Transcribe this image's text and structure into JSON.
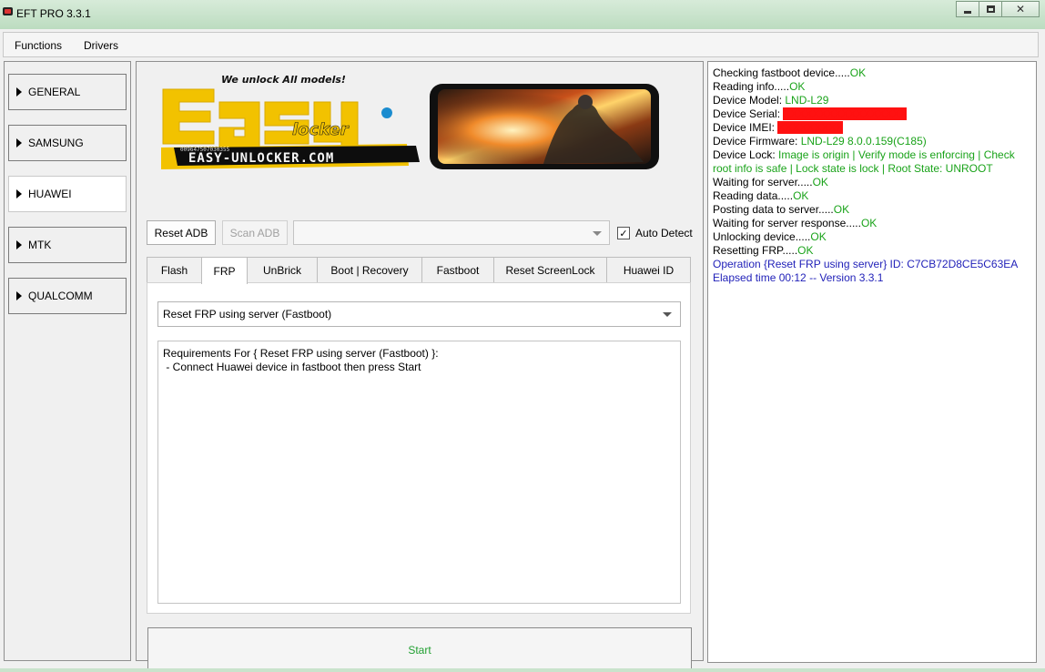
{
  "window": {
    "title": "EFT PRO 3.3.1"
  },
  "menu": [
    "Functions",
    "Drivers"
  ],
  "sidebar": {
    "items": [
      {
        "label": "GENERAL",
        "active": false
      },
      {
        "label": "SAMSUNG",
        "active": false
      },
      {
        "label": "HUAWEI",
        "active": true
      },
      {
        "label": "MTK",
        "active": false
      },
      {
        "label": "QUALCOMM",
        "active": false
      }
    ]
  },
  "banner": {
    "tagline": "We unlock All models!",
    "logo_word_top": "Easy",
    "logo_word_bottom": "locker",
    "phone_number": "009647507030355",
    "site": "EASY-UNLOCKER.COM"
  },
  "toolbar": {
    "reset_adb": "Reset ADB",
    "scan_adb": "Scan ADB",
    "device_combo_value": "",
    "auto_detect_label": "Auto Detect",
    "auto_detect_checked": true
  },
  "tabs": [
    "Flash",
    "FRP",
    "UnBrick",
    "Boot | Recovery",
    "Fastboot",
    "Reset ScreenLock",
    "Huawei ID"
  ],
  "active_tab": "FRP",
  "frp": {
    "operation": "Reset FRP using server (Fastboot)",
    "requirements": "Requirements For { Reset FRP using server (Fastboot) }:\n - Connect Huawei device in fastboot then press Start"
  },
  "start_label": "Start",
  "log": [
    {
      "text": "Checking fastboot device.....",
      "status": "OK"
    },
    {
      "text": "Reading info.....",
      "status": "OK"
    },
    {
      "text": "Device Model: ",
      "status": "LND-L29"
    },
    {
      "text": "Device Serial: ",
      "status": "",
      "redacted": true
    },
    {
      "text": "Device IMEI: ",
      "status": "",
      "redacted": true
    },
    {
      "text": "Device Firmware: ",
      "status": "LND-L29 8.0.0.159(C185)"
    },
    {
      "text": "Device Lock: ",
      "status": "Image is origin | Verify mode is enforcing | Check root info is safe | Lock state is lock | Root State: UNROOT"
    },
    {
      "text": "Waiting for server.....",
      "status": "OK"
    },
    {
      "text": "Reading data.....",
      "status": "OK"
    },
    {
      "text": "Posting data to server.....",
      "status": "OK"
    },
    {
      "text": "Waiting for server response.....",
      "status": "OK"
    },
    {
      "text": "Unlocking device.....",
      "status": "OK"
    },
    {
      "text": "Resetting FRP.....",
      "status": "OK"
    },
    {
      "text": "Operation {Reset FRP using server} ID: C7CB72D8CE5C63EA",
      "status": "",
      "color": "blue"
    },
    {
      "text": "Elapsed time 00:12 -- Version 3.3.1",
      "status": "",
      "color": "blue"
    }
  ],
  "colors": {
    "ok_green": "#1aa31a",
    "info_blue": "#1f1fb8",
    "banner_yellow": "#f2c200",
    "frame_green": "#c9e3cc"
  }
}
